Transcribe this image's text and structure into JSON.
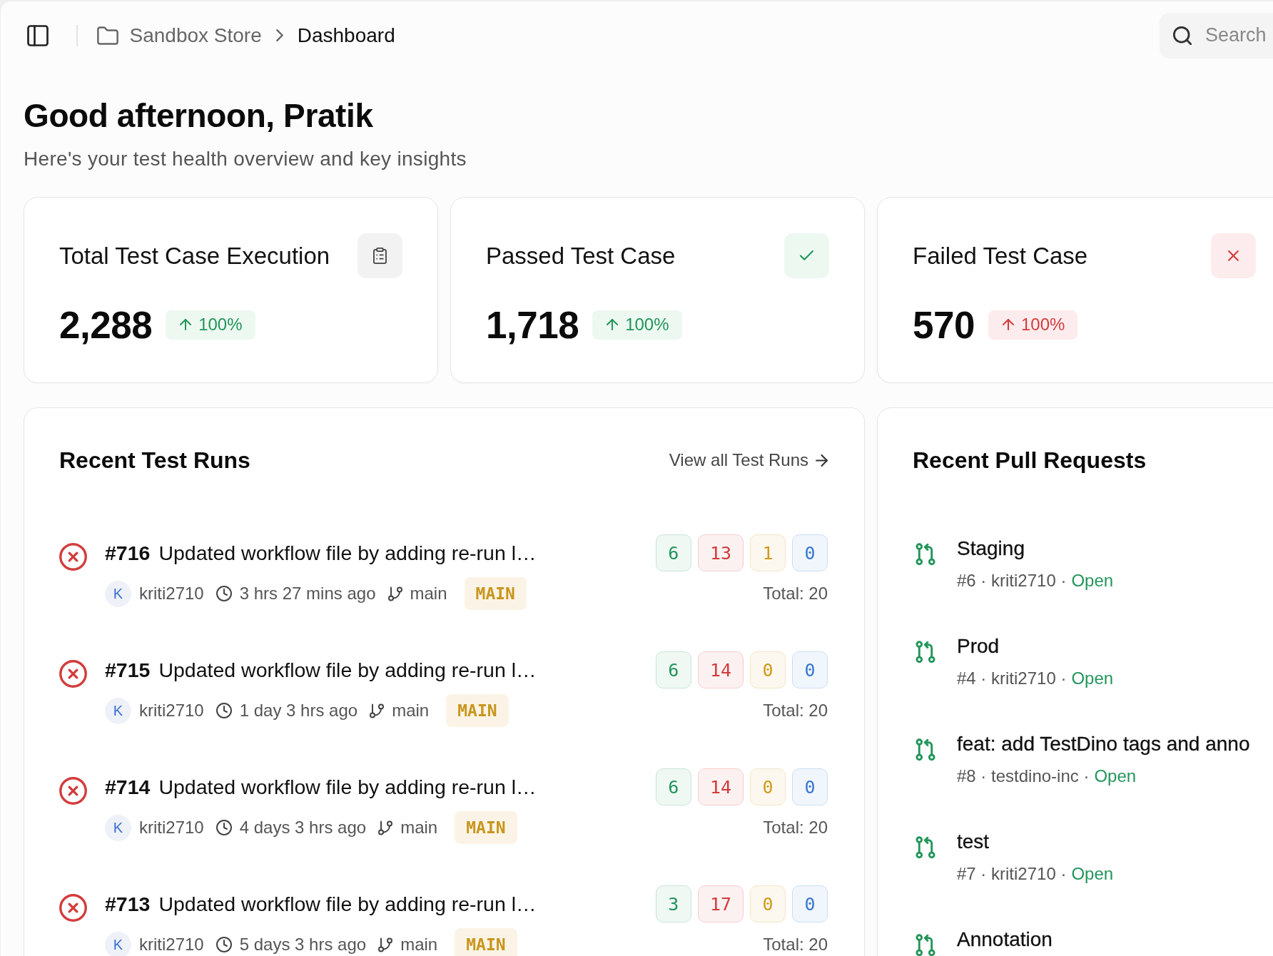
{
  "header": {
    "breadcrumb": [
      {
        "label": "Sandbox Store",
        "current": false
      },
      {
        "label": "Dashboard",
        "current": true
      }
    ],
    "search": {
      "placeholder": "Search"
    }
  },
  "greeting": {
    "title": "Good afternoon, Pratik",
    "subtitle": "Here's your test health overview and key insights"
  },
  "stats": [
    {
      "kind": "total",
      "title": "Total Test Case Execution",
      "value": "2,288",
      "change": "100%",
      "rising": true
    },
    {
      "kind": "passed",
      "title": "Passed Test Case",
      "value": "1,718",
      "change": "100%",
      "rising": true
    },
    {
      "kind": "failed",
      "title": "Failed Test Case",
      "value": "570",
      "change": "100%",
      "rising": true
    }
  ],
  "test_runs": {
    "title": "Recent Test Runs",
    "view_all": "View all Test Runs",
    "runs": [
      {
        "failed": true,
        "number": "#716",
        "title": "Updated workflow file by adding re-run l…",
        "author_initial": "K",
        "author": "kriti2710",
        "time": "3 hrs 27 mins ago",
        "branch": "main",
        "environment": "MAIN",
        "counts": [
          {
            "value": "6",
            "color": "#22955a"
          },
          {
            "value": "13",
            "color": "#d23c3c"
          },
          {
            "value": "1",
            "color": "#cf9a1c"
          },
          {
            "value": "0",
            "color": "#3878d0"
          }
        ],
        "total": "Total: 20"
      },
      {
        "failed": true,
        "number": "#715",
        "title": "Updated workflow file by adding re-run l…",
        "author_initial": "K",
        "author": "kriti2710",
        "time": "1 day 3 hrs ago",
        "branch": "main",
        "environment": "MAIN",
        "counts": [
          {
            "value": "6",
            "color": "#22955a"
          },
          {
            "value": "14",
            "color": "#d23c3c"
          },
          {
            "value": "0",
            "color": "#cf9a1c"
          },
          {
            "value": "0",
            "color": "#3878d0"
          }
        ],
        "total": "Total: 20"
      },
      {
        "failed": true,
        "number": "#714",
        "title": "Updated workflow file by adding re-run l…",
        "author_initial": "K",
        "author": "kriti2710",
        "time": "4 days 3 hrs ago",
        "branch": "main",
        "environment": "MAIN",
        "counts": [
          {
            "value": "6",
            "color": "#22955a"
          },
          {
            "value": "14",
            "color": "#d23c3c"
          },
          {
            "value": "0",
            "color": "#cf9a1c"
          },
          {
            "value": "0",
            "color": "#3878d0"
          }
        ],
        "total": "Total: 20"
      },
      {
        "failed": true,
        "number": "#713",
        "title": "Updated workflow file by adding re-run l…",
        "author_initial": "K",
        "author": "kriti2710",
        "time": "5 days 3 hrs ago",
        "branch": "main",
        "environment": "MAIN",
        "counts": [
          {
            "value": "3",
            "color": "#22955a"
          },
          {
            "value": "17",
            "color": "#d23c3c"
          },
          {
            "value": "0",
            "color": "#cf9a1c"
          },
          {
            "value": "0",
            "color": "#3878d0"
          }
        ],
        "total": "Total: 20"
      }
    ]
  },
  "pull_requests": {
    "title": "Recent Pull Requests",
    "items": [
      {
        "title": "Staging",
        "details": "#6 · kriti2710 ·",
        "status": "Open"
      },
      {
        "title": "Prod",
        "details": "#4 · kriti2710 ·",
        "status": "Open"
      },
      {
        "title": "feat: add TestDino tags and anno",
        "details": "#8 · testdino-inc ·",
        "status": "Open"
      },
      {
        "title": "test",
        "details": "#7 · kriti2710 ·",
        "status": "Open"
      },
      {
        "title": "Annotation"
      }
    ]
  }
}
